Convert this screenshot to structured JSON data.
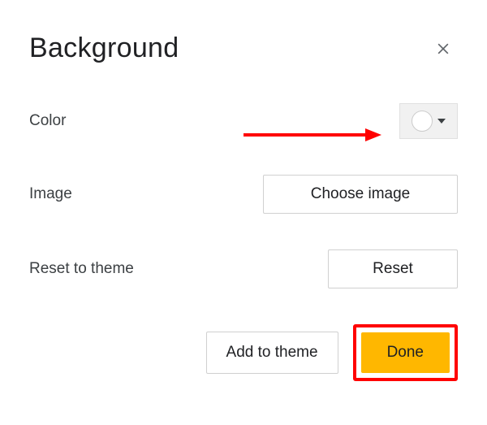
{
  "dialog": {
    "title": "Background"
  },
  "rows": {
    "color": {
      "label": "Color",
      "swatch_color": "#ffffff"
    },
    "image": {
      "label": "Image",
      "button": "Choose image"
    },
    "reset": {
      "label": "Reset to theme",
      "button": "Reset"
    }
  },
  "footer": {
    "add_to_theme": "Add to theme",
    "done": "Done"
  }
}
